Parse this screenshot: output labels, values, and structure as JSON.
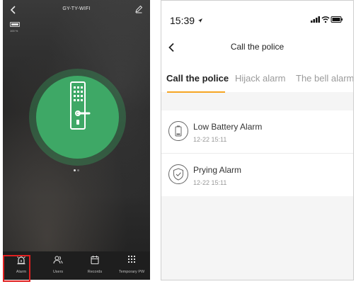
{
  "left_screen": {
    "device_name": "GY-TY-WIFI",
    "battery_percent": "100 %",
    "tabs": [
      {
        "label": "Alarm",
        "icon": "alarm-icon"
      },
      {
        "label": "Users",
        "icon": "users-icon"
      },
      {
        "label": "Records",
        "icon": "calendar-icon"
      },
      {
        "label": "Temporary PW",
        "icon": "keypad-icon"
      }
    ],
    "active_tab": "Alarm",
    "lock_color": "#3ea866"
  },
  "right_screen": {
    "status_time": "15:39",
    "title": "Call the police",
    "tabs": [
      "Call the police",
      "Hijack alarm",
      "The bell alarm"
    ],
    "active_tab": "Call the police",
    "accent_color": "#f5a623",
    "alarms": [
      {
        "title": "Low Battery Alarm",
        "time": "12-22 15:11",
        "icon": "battery-icon"
      },
      {
        "title": "Prying Alarm",
        "time": "12-22 15:11",
        "icon": "shield-icon"
      }
    ]
  },
  "highlight_color": "#e02020"
}
